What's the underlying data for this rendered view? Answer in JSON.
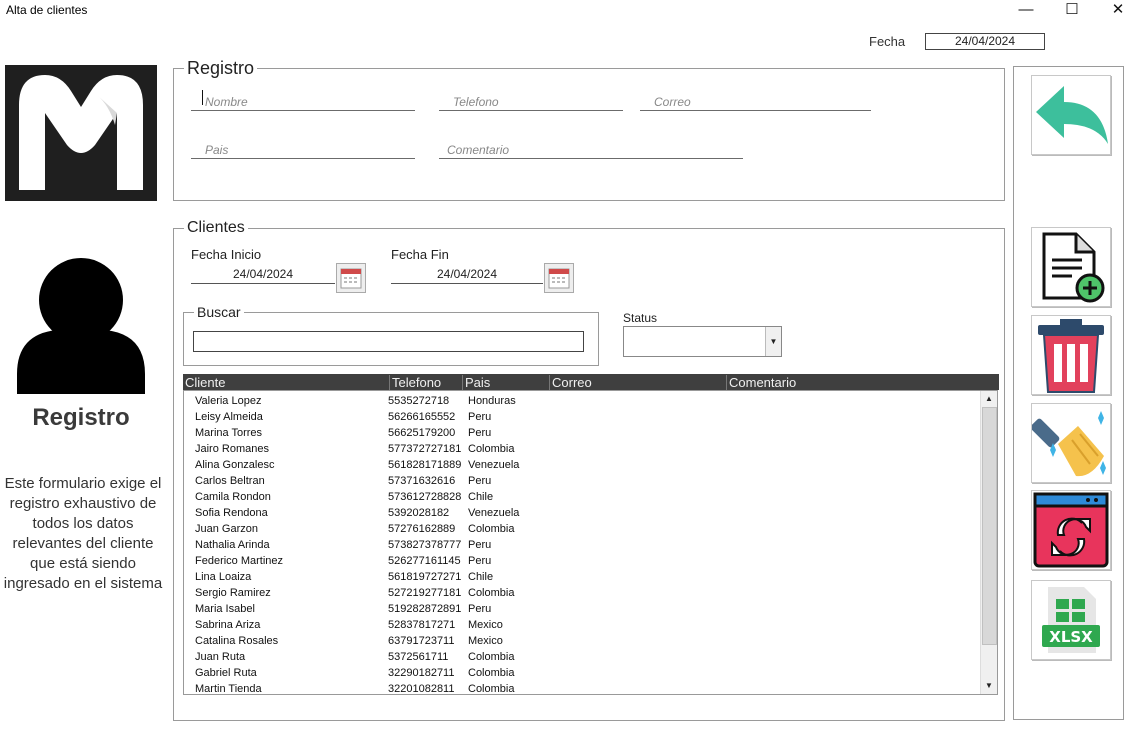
{
  "window": {
    "title": "Alta de clientes",
    "minimize": "—",
    "maximize": "☐",
    "close": "✕"
  },
  "header": {
    "fecha_label": "Fecha",
    "fecha_value": "24/04/2024"
  },
  "sidebar": {
    "title": "Registro",
    "description": "Este formulario exige el registro exhaustivo de todos los datos relevantes del cliente que está siendo ingresado en el sistema"
  },
  "registro": {
    "legend": "Registro",
    "nombre_placeholder": "Nombre",
    "telefono_placeholder": "Telefono",
    "correo_placeholder": "Correo",
    "pais_placeholder": "Pais",
    "comentario_placeholder": "Comentario"
  },
  "clientes": {
    "legend": "Clientes",
    "fecha_inicio_label": "Fecha Inicio",
    "fecha_inicio_value": "24/04/2024",
    "fecha_fin_label": "Fecha Fin",
    "fecha_fin_value": "24/04/2024",
    "buscar_legend": "Buscar",
    "status_label": "Status",
    "columns": [
      "Cliente",
      "Telefono",
      "Pais",
      "Correo",
      "Comentario"
    ],
    "rows": [
      [
        "Valeria Lopez",
        "5535272718",
        "Honduras"
      ],
      [
        "Leisy Almeida",
        "56266165552",
        "Peru"
      ],
      [
        "Marina Torres",
        "56625179200",
        "Peru"
      ],
      [
        "Jairo Romanes",
        "577372727181",
        "Colombia"
      ],
      [
        "Alina Gonzalesc",
        "561828171889",
        "Venezuela"
      ],
      [
        "Carlos Beltran",
        "57371632616",
        "Peru"
      ],
      [
        "Camila Rondon",
        "573612728828",
        "Chile"
      ],
      [
        "Sofia Rendona",
        "5392028182",
        "Venezuela"
      ],
      [
        "Juan Garzon",
        "57276162889",
        "Colombia"
      ],
      [
        "Nathalia Arinda",
        "573827378777",
        "Peru"
      ],
      [
        "Federico Martinez",
        "526277161145",
        "Peru"
      ],
      [
        "Lina Loaiza",
        "561819727271",
        "Chile"
      ],
      [
        "Sergio Ramirez",
        "527219277181",
        "Colombia"
      ],
      [
        "Maria Isabel",
        "519282872891",
        "Peru"
      ],
      [
        "Sabrina Ariza",
        "52837817271",
        "Mexico"
      ],
      [
        "Catalina Rosales",
        "63791723711",
        "Mexico"
      ],
      [
        "Juan Ruta",
        "5372561711",
        "Colombia"
      ],
      [
        "Gabriel Ruta",
        "32290182711",
        "Colombia"
      ],
      [
        "Martin Tienda",
        "32201082811",
        "Colombia"
      ]
    ]
  },
  "actions": [
    {
      "icon": "undo-arrow-icon"
    },
    {
      "icon": "add-document-icon"
    },
    {
      "icon": "trash-icon"
    },
    {
      "icon": "broom-clean-icon"
    },
    {
      "icon": "refresh-window-icon"
    },
    {
      "icon": "xlsx-export-icon",
      "label": "XLSX"
    }
  ],
  "colors": {
    "teal": "#3dbf9c",
    "red": "#e2415c",
    "dark": "#111111",
    "header_bg": "#3f3f3f"
  }
}
